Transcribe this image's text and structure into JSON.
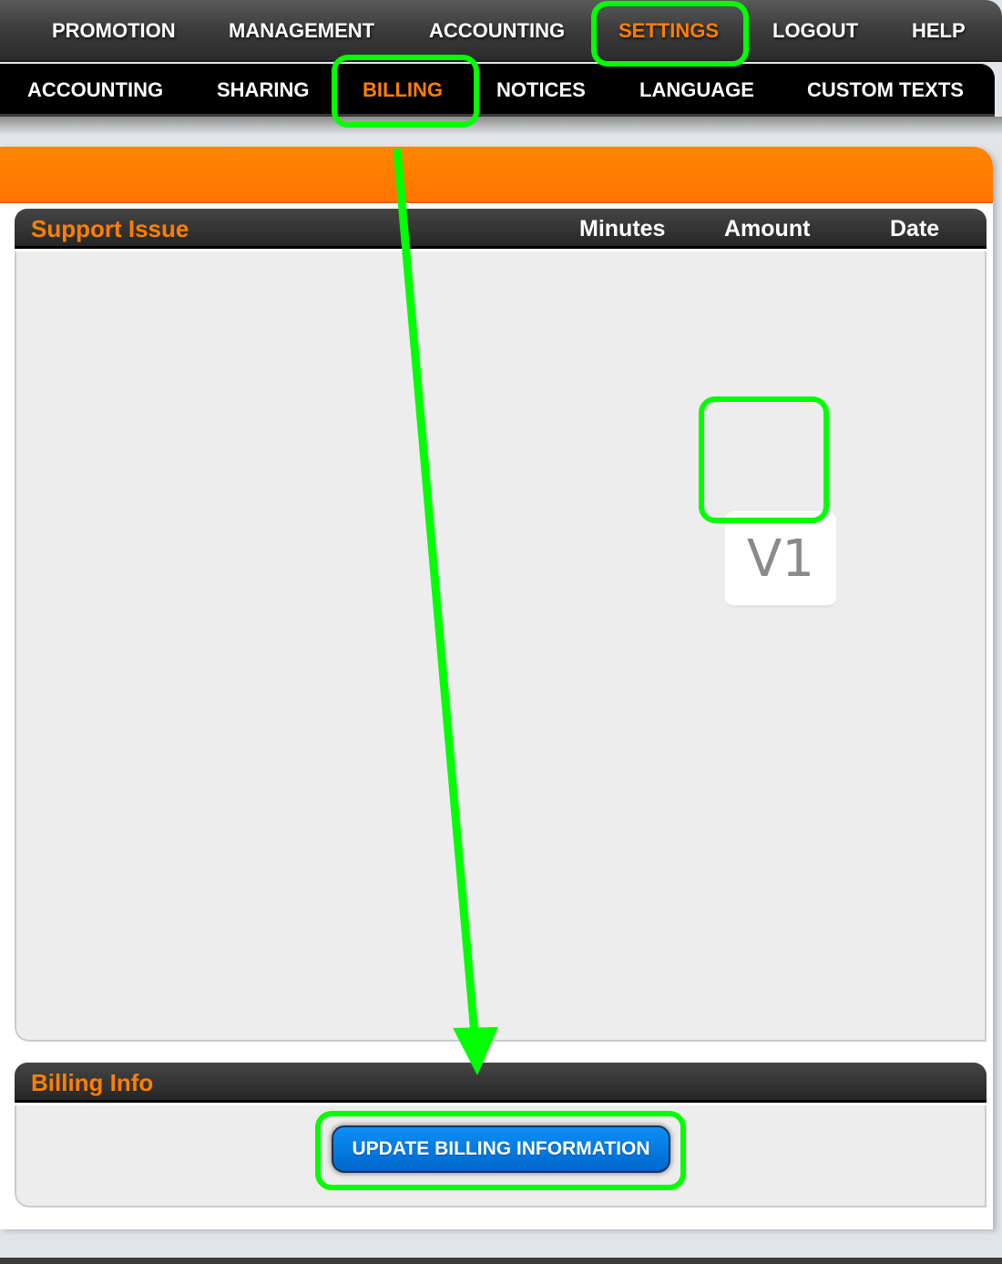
{
  "top_nav": {
    "items": [
      {
        "label": "PROMOTION",
        "active": false
      },
      {
        "label": "MANAGEMENT",
        "active": false
      },
      {
        "label": "ACCOUNTING",
        "active": false
      },
      {
        "label": "SETTINGS",
        "active": true
      },
      {
        "label": "LOGOUT",
        "active": false
      },
      {
        "label": "HELP",
        "active": false
      }
    ]
  },
  "sub_nav": {
    "items": [
      {
        "label": "ACCOUNTING",
        "active": false
      },
      {
        "label": "SHARING",
        "active": false
      },
      {
        "label": "BILLING",
        "active": true
      },
      {
        "label": "NOTICES",
        "active": false
      },
      {
        "label": "LANGUAGE",
        "active": false
      },
      {
        "label": "CUSTOM TEXTS",
        "active": false
      }
    ]
  },
  "support_table": {
    "title": "Support Issue",
    "columns": [
      "Minutes",
      "Amount",
      "Date"
    ],
    "rows": []
  },
  "version_badge": "V1",
  "billing_info": {
    "title": "Billing Info",
    "update_button_label": "UPDATE BILLING INFORMATION"
  },
  "colors": {
    "accent_orange": "#ff7f00",
    "button_blue": "#0a7fe6",
    "annotation_green": "#00ff00",
    "nav_dark": "#2b2b2b"
  }
}
